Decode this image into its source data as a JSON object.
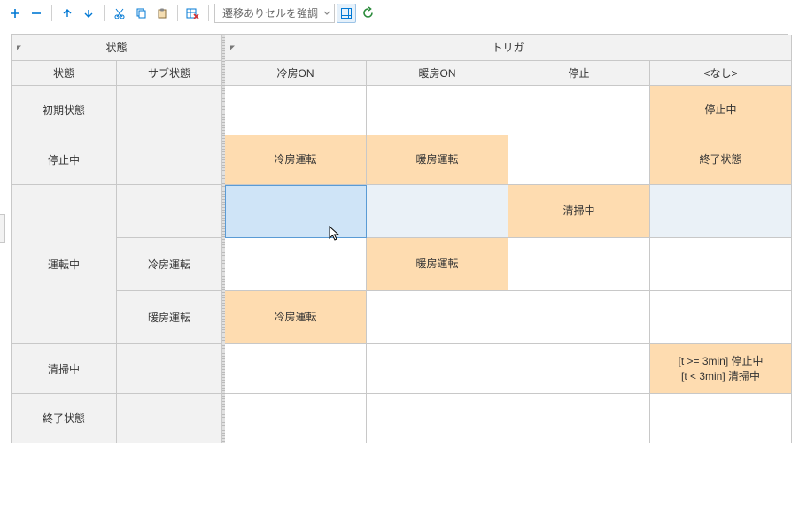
{
  "toolbar": {
    "dropdown_label": "遷移ありセルを強調"
  },
  "headers": {
    "state_group": "状態",
    "trigger_group": "トリガ",
    "state": "状態",
    "substate": "サブ状態",
    "triggers": [
      "冷房ON",
      "暖房ON",
      "停止",
      "<なし>"
    ]
  },
  "rows": [
    {
      "state": "初期状態",
      "substate": "",
      "cells": [
        "",
        "",
        "",
        "停止中"
      ],
      "hl": [
        false,
        false,
        false,
        true
      ]
    },
    {
      "state": "停止中",
      "substate": "",
      "cells": [
        "冷房運転",
        "暖房運転",
        "",
        "終了状態"
      ],
      "hl": [
        true,
        true,
        false,
        true
      ]
    },
    {
      "state": "運転中",
      "substate": "",
      "cells": [
        "",
        "",
        "清掃中",
        ""
      ],
      "hl": [
        false,
        false,
        true,
        false
      ],
      "selected": true
    },
    {
      "state": "",
      "substate": "冷房運転",
      "cells": [
        "",
        "暖房運転",
        "",
        ""
      ],
      "hl": [
        false,
        true,
        false,
        false
      ]
    },
    {
      "state": "",
      "substate": "暖房運転",
      "cells": [
        "冷房運転",
        "",
        "",
        ""
      ],
      "hl": [
        true,
        false,
        false,
        false
      ]
    },
    {
      "state": "清掃中",
      "substate": "",
      "cells": [
        "",
        "",
        "",
        "[t >= 3min] 停止中\n[t < 3min] 清掃中"
      ],
      "hl": [
        false,
        false,
        false,
        true
      ]
    },
    {
      "state": "終了状態",
      "substate": "",
      "cells": [
        "",
        "",
        "",
        ""
      ],
      "hl": [
        false,
        false,
        false,
        false
      ]
    }
  ]
}
